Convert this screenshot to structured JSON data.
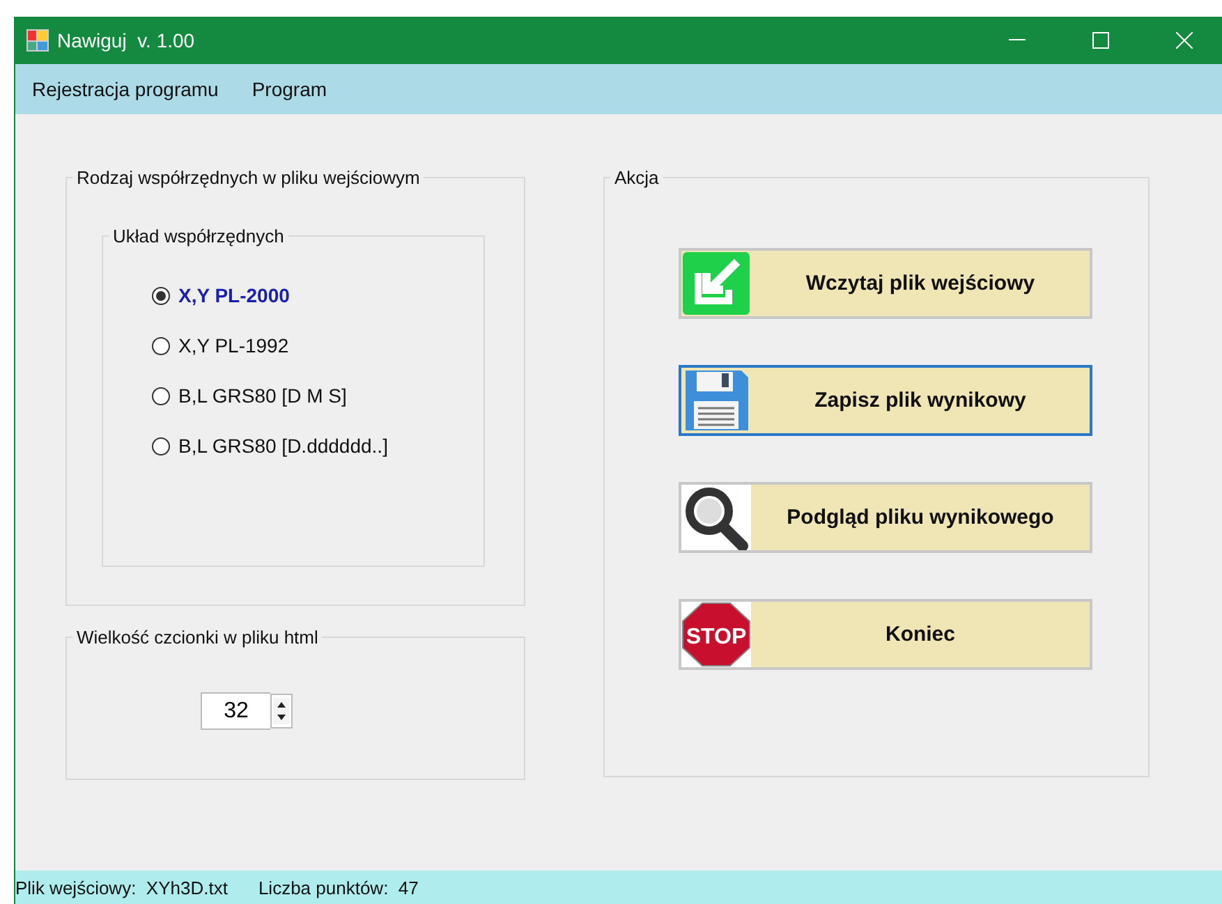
{
  "window": {
    "title": "Nawiguj  v. 1.00"
  },
  "menu": [
    {
      "label": "Rejestracja programu"
    },
    {
      "label": "Program"
    }
  ],
  "coordinates_group": {
    "title": "Rodzaj współrzędnych w pliku wejściowym",
    "system_group": {
      "title": "Układ współrzędnych",
      "options": [
        {
          "label": "X,Y  PL-2000",
          "selected": true
        },
        {
          "label": "X,Y  PL-1992",
          "selected": false
        },
        {
          "label": "B,L  GRS80  [D M S]",
          "selected": false
        },
        {
          "label": "B,L GRS80  [D.dddddd..]",
          "selected": false
        }
      ]
    }
  },
  "font_size_group": {
    "title": "Wielkość czcionki w pliku html",
    "value": "32"
  },
  "action_group": {
    "title": "Akcja",
    "buttons": [
      {
        "label": "Wczytaj plik wejściowy",
        "kind": "import",
        "focused": false
      },
      {
        "label": "Zapisz plik wynikowy",
        "kind": "save",
        "focused": true
      },
      {
        "label": "Podgląd pliku wynikowego",
        "kind": "search",
        "focused": false
      },
      {
        "label": "Koniec",
        "kind": "stop",
        "icon_text": "STOP",
        "focused": false
      }
    ]
  },
  "status_bar": [
    {
      "label": "Plik wejściowy:",
      "value": "XYh3D.txt"
    },
    {
      "label": "Liczba punktów:",
      "value": "47"
    }
  ]
}
